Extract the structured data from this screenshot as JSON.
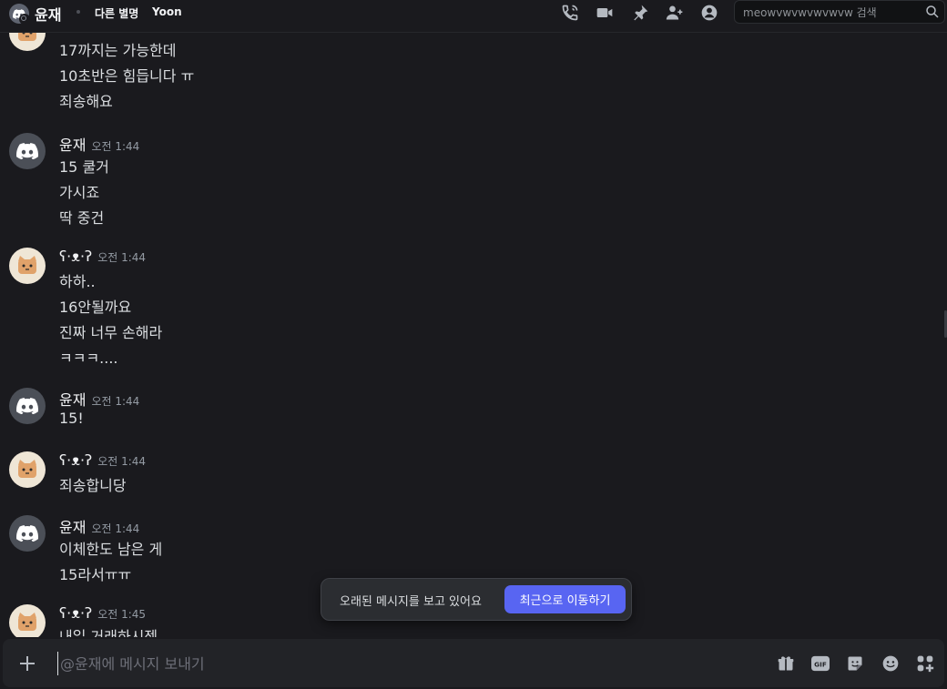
{
  "header": {
    "title": "윤재",
    "alias_label": "다른 별명",
    "alias_value": "Yoon",
    "search_placeholder": "meowvwvwvwvwvw 검색",
    "icons": [
      "voice-call-icon",
      "video-call-icon",
      "pin-icon",
      "add-friend-icon",
      "user-profile-icon",
      "search-icon"
    ]
  },
  "messages": [
    {
      "author": "",
      "time": "",
      "avatar": "cat",
      "lines": [
        "17까지는 가능한데",
        "10초반은 힘듭니다 ㅠ",
        "죄송해요"
      ]
    },
    {
      "author": "윤재",
      "time": "오전 1:44",
      "avatar": "discord",
      "lines": [
        "15 쿨거",
        "가시죠",
        "딱 중건"
      ]
    },
    {
      "author": "ʕ·ᴥ·ʔ",
      "time": "오전 1:44",
      "avatar": "cat",
      "lines": [
        "하하..",
        "16안될까요",
        "진짜 너무 손해라",
        "ㅋㅋㅋ...."
      ]
    },
    {
      "author": "윤재",
      "time": "오전 1:44",
      "avatar": "discord",
      "lines": [
        "15!"
      ]
    },
    {
      "author": "ʕ·ᴥ·ʔ",
      "time": "오전 1:44",
      "avatar": "cat",
      "lines": [
        "죄송합니당"
      ]
    },
    {
      "author": "윤재",
      "time": "오전 1:44",
      "avatar": "discord",
      "lines": [
        "이체한도 남은 게",
        "15라서ㅠㅠ"
      ]
    },
    {
      "author": "ʕ·ᴥ·ʔ",
      "time": "오전 1:45",
      "avatar": "cat",
      "lines": [
        "내일 거래하시젰"
      ]
    }
  ],
  "banner": {
    "text": "오래된 메시지를 보고 있어요",
    "button": "최근으로 이동하기"
  },
  "composer": {
    "placeholder": "@윤재에 메시지 보내기",
    "icons": [
      "add-attachment-icon",
      "gift-icon",
      "gif-icon",
      "sticker-icon",
      "emoji-icon",
      "apps-icon"
    ]
  },
  "colors": {
    "accent": "#5865f2",
    "background": "#1a1a1e",
    "composer": "#222327"
  }
}
